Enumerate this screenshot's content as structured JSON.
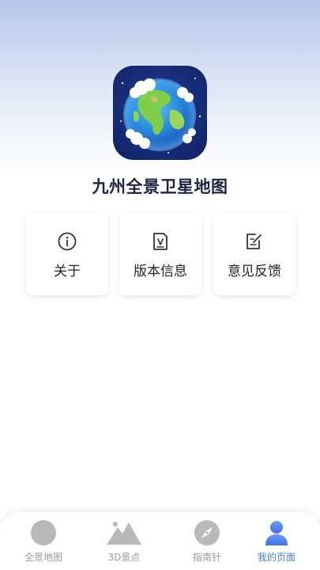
{
  "app": {
    "title": "九州全景卫星地图",
    "icon": "earth-globe-icon"
  },
  "menu": [
    {
      "label": "关于",
      "icon": "info-icon"
    },
    {
      "label": "版本信息",
      "icon": "document-version-icon"
    },
    {
      "label": "意见反馈",
      "icon": "edit-feedback-icon"
    }
  ],
  "tabbar": {
    "active_index": 3,
    "active_color": "#4a7bea",
    "inactive_color": "#9a9a9a",
    "items": [
      {
        "label": "全景地图",
        "icon": "globe-tab-icon"
      },
      {
        "label": "3D景点",
        "icon": "mountain-icon"
      },
      {
        "label": "指南针",
        "icon": "compass-icon"
      },
      {
        "label": "我的页面",
        "icon": "user-icon"
      }
    ]
  }
}
